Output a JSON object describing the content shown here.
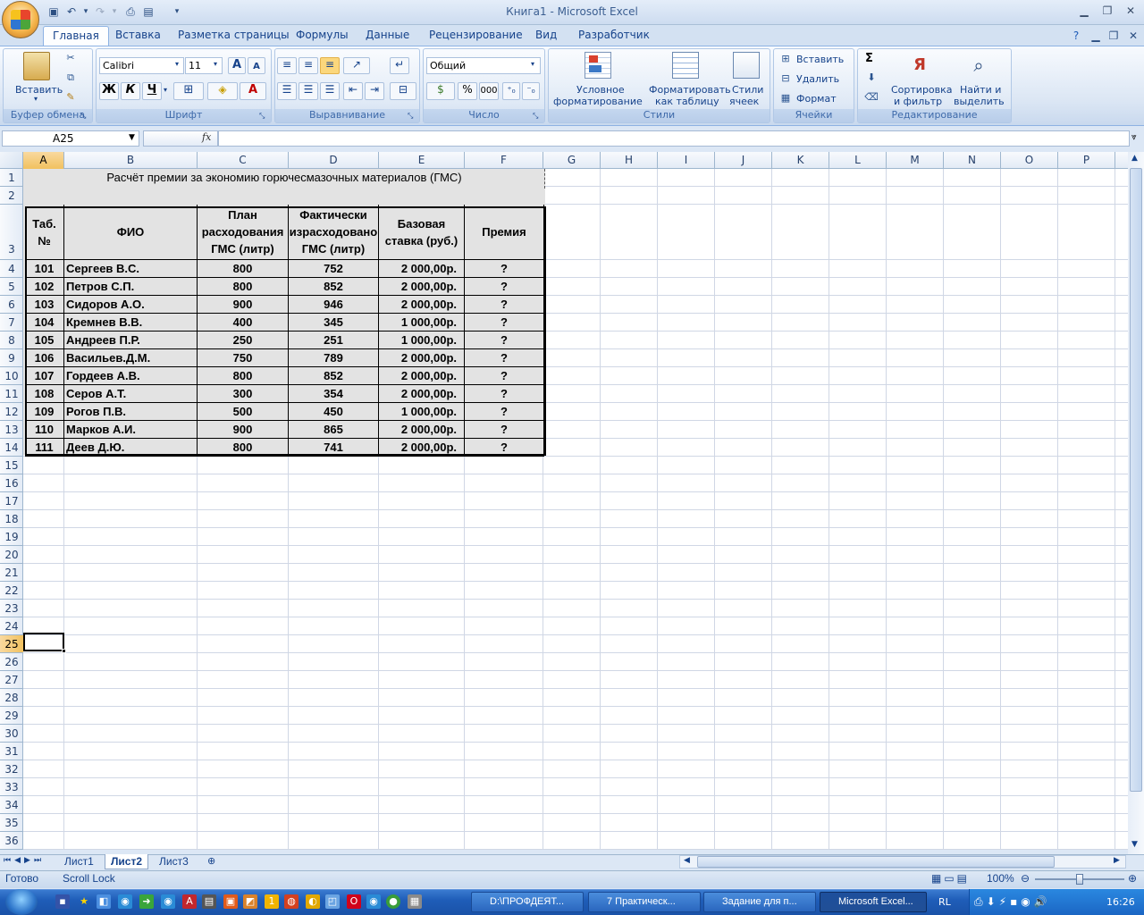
{
  "window": {
    "title": "Книга1 - Microsoft Excel"
  },
  "tabs": [
    "Главная",
    "Вставка",
    "Разметка страницы",
    "Формулы",
    "Данные",
    "Рецензирование",
    "Вид",
    "Разработчик"
  ],
  "ribbon": {
    "clipboard": {
      "label": "Буфер обмена",
      "paste": "Вставить"
    },
    "font": {
      "label": "Шрифт",
      "name": "Calibri",
      "size": "11",
      "bold": "Ж",
      "italic": "К",
      "underline": "Ч"
    },
    "alignment": {
      "label": "Выравнивание"
    },
    "number": {
      "label": "Число",
      "format": "Общий",
      "percent": "%",
      "thousands": "000"
    },
    "styles": {
      "label": "Стили",
      "conditional": "Условное",
      "conditional2": "форматирование",
      "astable": "Форматировать",
      "astable2": "как таблицу",
      "cellstyles": "Стили",
      "cellstyles2": "ячеек"
    },
    "cells": {
      "label": "Ячейки",
      "insert": "Вставить",
      "delete": "Удалить",
      "format": "Формат"
    },
    "editing": {
      "label": "Редактирование",
      "sigma": "Σ",
      "sort": "Сортировка",
      "sort2": "и фильтр",
      "find": "Найти и",
      "find2": "выделить"
    }
  },
  "formula_bar": {
    "name_box": "A25",
    "fx": "fx",
    "value": ""
  },
  "columns": [
    "A",
    "B",
    "C",
    "D",
    "E",
    "F",
    "G",
    "H",
    "I",
    "J",
    "K",
    "L",
    "M",
    "N",
    "O",
    "P"
  ],
  "rows": [
    "1",
    "2",
    "3",
    "4",
    "5",
    "6",
    "7",
    "8",
    "9",
    "10",
    "11",
    "12",
    "13",
    "14",
    "15",
    "16",
    "17",
    "18",
    "19",
    "20",
    "21",
    "22",
    "23",
    "24",
    "25",
    "26",
    "27",
    "28",
    "29",
    "30",
    "31",
    "32",
    "33",
    "34",
    "35",
    "36"
  ],
  "sheet": {
    "title": "Расчёт премии за экономию горючесмазочных материалов (ГМС)",
    "headers": {
      "tab1": "Таб.",
      "tab2": "№",
      "fio": "ФИО",
      "plan1": "План",
      "plan2": "расходования",
      "plan3": "ГМС (литр)",
      "fact1": "Фактически",
      "fact2": "израсходовано",
      "fact3": "ГМС (литр)",
      "base1": "Базовая",
      "base2": "ставка (руб.)",
      "bonus": "Премия"
    },
    "rows": [
      {
        "id": "101",
        "name": "Сергеев В.С.",
        "plan": "800",
        "fact": "752",
        "rate": "2 000,00р.",
        "bonus": "?"
      },
      {
        "id": "102",
        "name": "Петров С.П.",
        "plan": "800",
        "fact": "852",
        "rate": "2 000,00р.",
        "bonus": "?"
      },
      {
        "id": "103",
        "name": "Сидоров А.О.",
        "plan": "900",
        "fact": "946",
        "rate": "2 000,00р.",
        "bonus": "?"
      },
      {
        "id": "104",
        "name": "Кремнев В.В.",
        "plan": "400",
        "fact": "345",
        "rate": "1 000,00р.",
        "bonus": "?"
      },
      {
        "id": "105",
        "name": "Андреев П.Р.",
        "plan": "250",
        "fact": "251",
        "rate": "1 000,00р.",
        "bonus": "?"
      },
      {
        "id": "106",
        "name": "Васильев.Д.М.",
        "plan": "750",
        "fact": "789",
        "rate": "2 000,00р.",
        "bonus": "?"
      },
      {
        "id": "107",
        "name": "Гордеев А.В.",
        "plan": "800",
        "fact": "852",
        "rate": "2 000,00р.",
        "bonus": "?"
      },
      {
        "id": "108",
        "name": "Серов А.Т.",
        "plan": "300",
        "fact": "354",
        "rate": "2 000,00р.",
        "bonus": "?"
      },
      {
        "id": "109",
        "name": "Рогов П.В.",
        "plan": "500",
        "fact": "450",
        "rate": "1 000,00р.",
        "bonus": "?"
      },
      {
        "id": "110",
        "name": "Марков А.И.",
        "plan": "900",
        "fact": "865",
        "rate": "2 000,00р.",
        "bonus": "?"
      },
      {
        "id": "111",
        "name": "Деев Д.Ю.",
        "plan": "800",
        "fact": "741",
        "rate": "2 000,00р.",
        "bonus": "?"
      }
    ]
  },
  "sheet_tabs": [
    "Лист1",
    "Лист2",
    "Лист3"
  ],
  "active_sheet": "Лист2",
  "status": {
    "ready": "Готово",
    "scroll_lock": "Scroll Lock",
    "zoom": "100%"
  },
  "taskbar": {
    "tasks": [
      "D:\\ПРОФДЕЯТ...",
      "7 Практическ...",
      "Задание для п...",
      "Microsoft Excel..."
    ],
    "lang": "RL",
    "time": "16:26"
  },
  "colors": {
    "ribbon_bg": "#dbe6f4",
    "selected_header": "#f1c15f",
    "table_fill": "#e3e3e3",
    "taskbar": "#1f5db8"
  }
}
